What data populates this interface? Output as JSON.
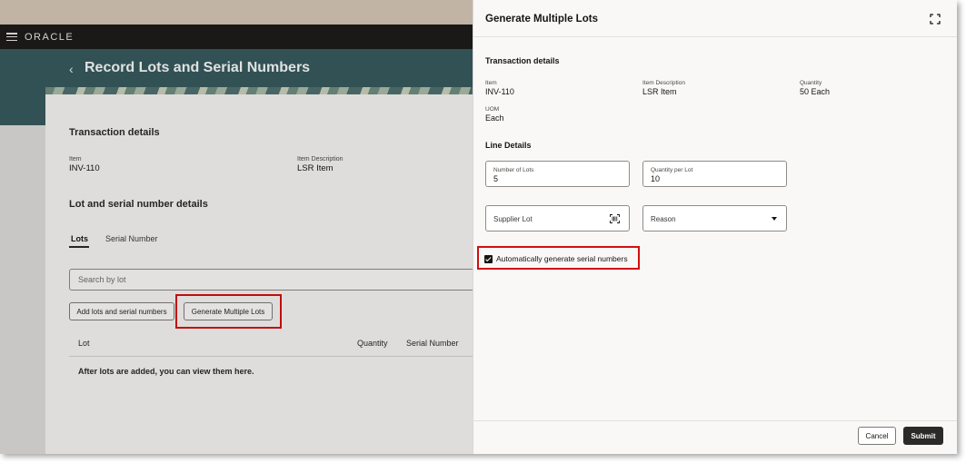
{
  "app": {
    "brand": "ORACLE",
    "page_title": "Record Lots and Serial Numbers"
  },
  "background": {
    "transaction_details": {
      "title": "Transaction details",
      "item_label": "Item",
      "item_value": "INV-110",
      "desc_label": "Item Description",
      "desc_value": "LSR Item"
    },
    "lot_serial": {
      "title": "Lot and serial number details",
      "tabs": [
        {
          "label": "Lots",
          "active": true
        },
        {
          "label": "Serial Number",
          "active": false
        }
      ],
      "search_placeholder": "Search by lot",
      "add_button": "Add lots and serial numbers",
      "generate_button": "Generate Multiple Lots",
      "columns": [
        "Lot",
        "Quantity",
        "Serial Number"
      ],
      "empty_message": "After lots are added, you can view them here."
    }
  },
  "drawer": {
    "title": "Generate Multiple Lots",
    "transaction_details": {
      "title": "Transaction details",
      "item_label": "Item",
      "item_value": "INV-110",
      "desc_label": "Item Description",
      "desc_value": "LSR Item",
      "qty_label": "Quantity",
      "qty_value": "50 Each",
      "uom_label": "UOM",
      "uom_value": "Each"
    },
    "line_details": {
      "title": "Line Details",
      "num_lots_label": "Number of Lots",
      "num_lots_value": "5",
      "qty_per_lot_label": "Quantity per Lot",
      "qty_per_lot_value": "10",
      "supplier_lot_placeholder": "Supplier Lot",
      "reason_placeholder": "Reason"
    },
    "auto_serial": {
      "label": "Automatically generate serial numbers",
      "checked": true
    },
    "footer": {
      "cancel": "Cancel",
      "submit": "Submit"
    }
  },
  "colors": {
    "highlight": "#d10f0f",
    "header_teal": "#37585c",
    "app_bar": "#1d1c1b",
    "primary_button": "#2b2a28"
  }
}
